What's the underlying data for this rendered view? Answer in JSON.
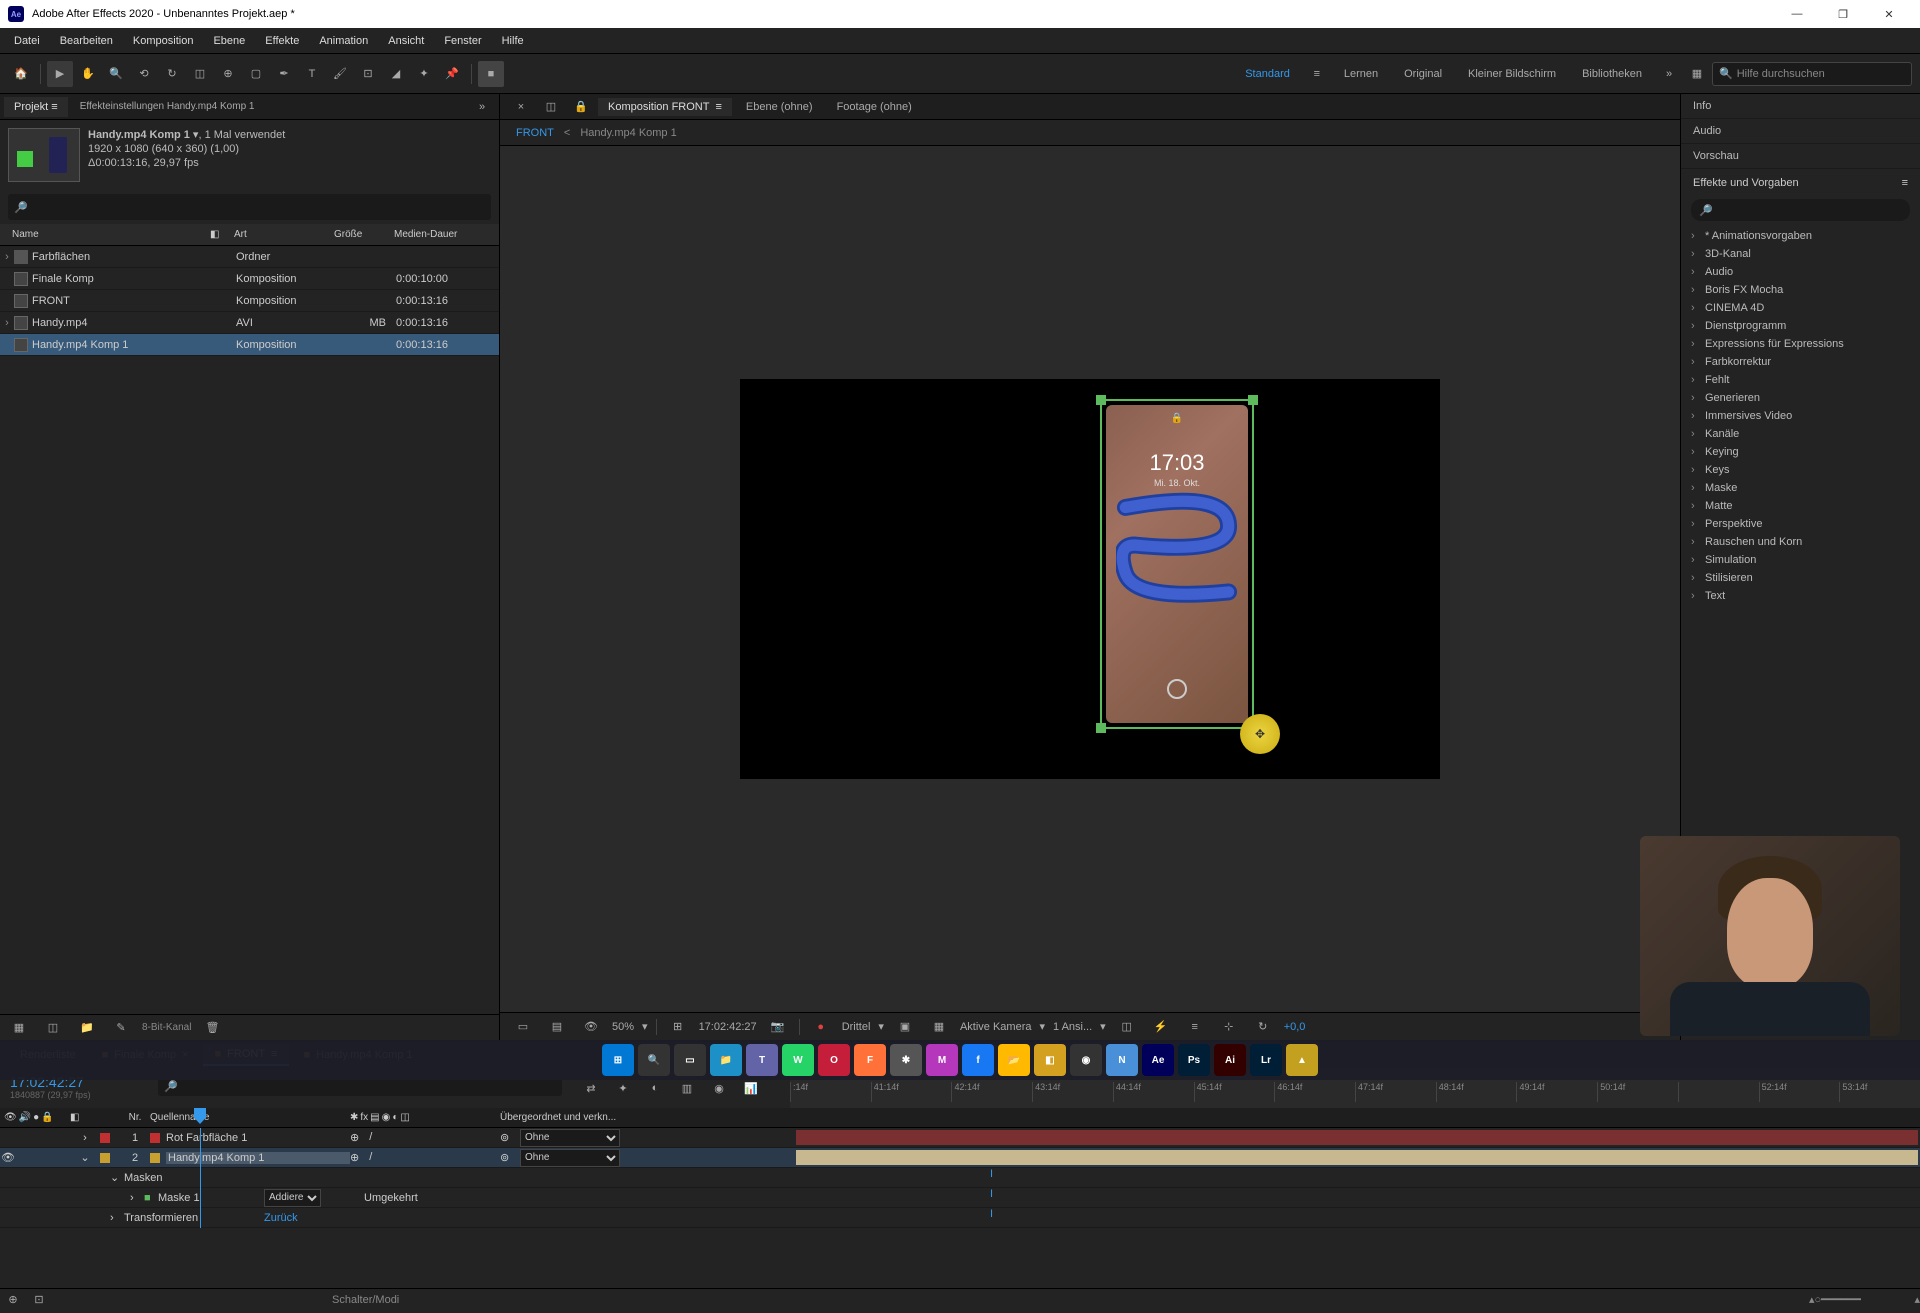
{
  "window": {
    "title": "Adobe After Effects 2020 - Unbenanntes Projekt.aep *"
  },
  "menu": {
    "items": [
      "Datei",
      "Bearbeiten",
      "Komposition",
      "Ebene",
      "Effekte",
      "Animation",
      "Ansicht",
      "Fenster",
      "Hilfe"
    ]
  },
  "workspaces": {
    "items": [
      "Standard",
      "Lernen",
      "Original",
      "Kleiner Bildschirm",
      "Bibliotheken"
    ],
    "active": 0
  },
  "search": {
    "placeholder": "Hilfe durchsuchen"
  },
  "project": {
    "tab": "Projekt",
    "effectsTab": "Effekteinstellungen Handy.mp4 Komp 1",
    "selectedName": "Handy.mp4 Komp 1",
    "usage": ", 1 Mal verwendet",
    "res": "1920 x 1080 (640 x 360) (1,00)",
    "dur": "Δ0:00:13:16, 29,97 fps",
    "cols": {
      "name": "Name",
      "art": "Art",
      "size": "Größe",
      "dur": "Medien-Dauer"
    },
    "rows": [
      {
        "name": "Farbflächen",
        "art": "Ordner",
        "size": "",
        "dur": "",
        "icon": "folder",
        "expand": true
      },
      {
        "name": "Finale Komp",
        "art": "Komposition",
        "size": "",
        "dur": "0:00:10:00",
        "icon": "comp"
      },
      {
        "name": "FRONT",
        "art": "Komposition",
        "size": "",
        "dur": "0:00:13:16",
        "icon": "comp"
      },
      {
        "name": "Handy.mp4",
        "art": "AVI",
        "size": "MB",
        "dur": "0:00:13:16",
        "icon": "video",
        "expand": true
      },
      {
        "name": "Handy.mp4 Komp 1",
        "art": "Komposition",
        "size": "",
        "dur": "0:00:13:16",
        "icon": "comp",
        "selected": true
      }
    ],
    "bitdepth": "8-Bit-Kanal"
  },
  "viewer": {
    "tabs": [
      {
        "label": "Komposition FRONT",
        "close": true,
        "active": true
      },
      {
        "label": "Ebene (ohne)"
      },
      {
        "label": "Footage (ohne)"
      }
    ],
    "breadcrumb": {
      "active": "FRONT",
      "sep": "<",
      "next": "Handy.mp4 Komp 1"
    },
    "zoom": "50%",
    "timecode": "17:02:42:27",
    "resolution": "Drittel",
    "camera": "Aktive Kamera",
    "views": "1 Ansi...",
    "offset": "+0,0",
    "phone": {
      "time": "17:03",
      "lock": "🔒",
      "date": "Mi. 18. Okt."
    }
  },
  "right": {
    "panels": [
      "Info",
      "Audio",
      "Vorschau"
    ],
    "effects": {
      "title": "Effekte und Vorgaben",
      "items": [
        "* Animationsvorgaben",
        "3D-Kanal",
        "Audio",
        "Boris FX Mocha",
        "CINEMA 4D",
        "Dienstprogramm",
        "Expressions für Expressions",
        "Farbkorrektur",
        "Fehlt",
        "Generieren",
        "Immersives Video",
        "Kanäle",
        "Keying",
        "Keys",
        "Maske",
        "Matte",
        "Perspektive",
        "Rauschen und Korn",
        "Simulation",
        "Stilisieren",
        "Text"
      ]
    }
  },
  "timeline": {
    "tabs": [
      {
        "label": "Renderliste"
      },
      {
        "label": "Finale Komp",
        "close": true
      },
      {
        "label": "FRONT",
        "close": true,
        "active": true
      },
      {
        "label": "Handy.mp4 Komp 1",
        "close": true
      }
    ],
    "timecode": "17:02:42:27",
    "frame": "1840887 (29,97 fps)",
    "ruler": [
      ":14f",
      "41:14f",
      "42:14f",
      "43:14f",
      "44:14f",
      "45:14f",
      "46:14f",
      "47:14f",
      "48:14f",
      "49:14f",
      "50:14f",
      "",
      "52:14f",
      "53:14f"
    ],
    "cols": {
      "num": "Nr.",
      "name": "Quellenname",
      "parent": "Übergeordnet und verkn..."
    },
    "layers": [
      {
        "num": "1",
        "name": "Rot Farbfläche 1",
        "swatch": "red",
        "parent": "Ohne",
        "barClass": "bar-red"
      },
      {
        "num": "2",
        "name": "Handy.mp4 Komp 1",
        "swatch": "yel",
        "parent": "Ohne",
        "barClass": "bar-tan",
        "selected": true,
        "eye": true
      }
    ],
    "sublayers": {
      "masken": "Masken",
      "maske1": "Maske 1",
      "mode": "Addiere",
      "link": "Zurück",
      "invert": "Umgekehrt",
      "transform": "Transformieren"
    },
    "footer": "Schalter/Modi"
  },
  "taskbar": {
    "items": [
      {
        "name": "start",
        "bg": "#0078d4",
        "txt": "⊞"
      },
      {
        "name": "search",
        "bg": "#333",
        "txt": "🔍"
      },
      {
        "name": "tasks",
        "bg": "#333",
        "txt": "▭"
      },
      {
        "name": "explorer",
        "bg": "#1e90c8",
        "txt": "📁"
      },
      {
        "name": "teams",
        "bg": "#6264a7",
        "txt": "T"
      },
      {
        "name": "whatsapp",
        "bg": "#25d366",
        "txt": "W"
      },
      {
        "name": "opera",
        "bg": "#c41e3a",
        "txt": "O"
      },
      {
        "name": "firefox",
        "bg": "#ff7139",
        "txt": "F"
      },
      {
        "name": "app1",
        "bg": "#555",
        "txt": "✱"
      },
      {
        "name": "messenger",
        "bg": "#b537bb",
        "txt": "M"
      },
      {
        "name": "facebook",
        "bg": "#1877f2",
        "txt": "f"
      },
      {
        "name": "folder",
        "bg": "#ffb900",
        "txt": "📂"
      },
      {
        "name": "app2",
        "bg": "#d4a020",
        "txt": "◧"
      },
      {
        "name": "obs",
        "bg": "#333",
        "txt": "◉"
      },
      {
        "name": "notepad",
        "bg": "#4a90d9",
        "txt": "N"
      },
      {
        "name": "ae",
        "bg": "#00005b",
        "txt": "Ae"
      },
      {
        "name": "ps",
        "bg": "#001e36",
        "txt": "Ps"
      },
      {
        "name": "ai",
        "bg": "#330000",
        "txt": "Ai"
      },
      {
        "name": "lr",
        "bg": "#001e36",
        "txt": "Lr"
      },
      {
        "name": "app3",
        "bg": "#c4a020",
        "txt": "▲"
      }
    ]
  }
}
